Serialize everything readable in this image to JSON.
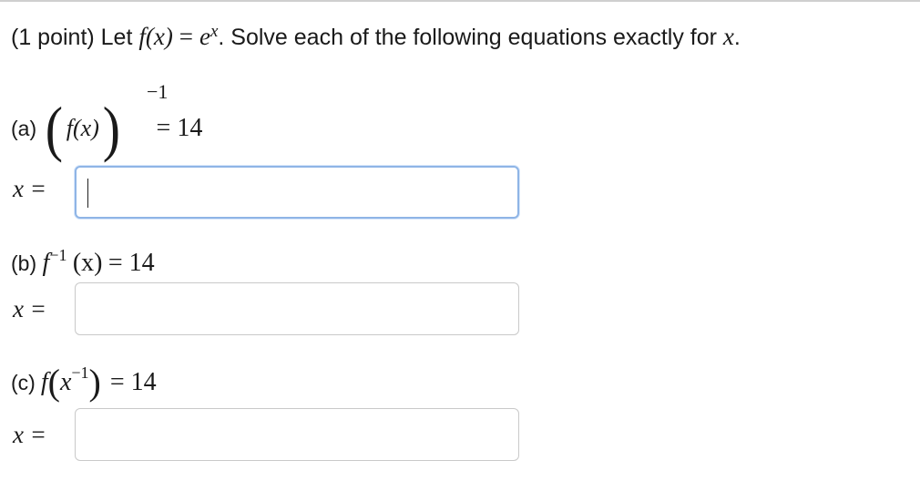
{
  "problem": {
    "points_label": "(1 point) Let",
    "function_lhs": "f(x)",
    "equals": "=",
    "base": "e",
    "exponent": "x",
    "instruction": ". Solve each of the following equations exactly for",
    "variable": "x",
    "period": "."
  },
  "parts": [
    {
      "label": "(a)",
      "fx": "f(x)",
      "exponent": "−1",
      "rhs": "= 14",
      "answer_prefix": "x =",
      "answer_value": ""
    },
    {
      "label": "(b)",
      "f": "f",
      "exponent": "−1",
      "arg": "(x)",
      "rhs": "= 14",
      "answer_prefix": "x =",
      "answer_value": ""
    },
    {
      "label": "(c)",
      "f": "f",
      "x": "x",
      "exponent": "−1",
      "rhs": "= 14",
      "answer_prefix": "x =",
      "answer_value": ""
    }
  ],
  "colors": {
    "focus_border": "#8fb5e6",
    "input_border": "#c9c9c9",
    "text": "#1a1a1a"
  }
}
